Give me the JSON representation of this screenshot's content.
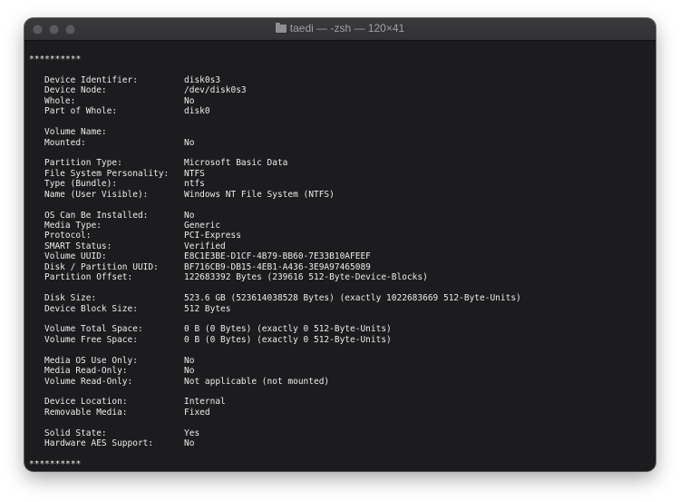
{
  "window": {
    "title": "taedi — -zsh — 120×41",
    "folder_icon": "folder-icon"
  },
  "terminal": {
    "separator_top": "**********",
    "separator_bottom": "**********",
    "groups": [
      [
        {
          "label": "Device Identifier:",
          "value": "disk0s3"
        },
        {
          "label": "Device Node:",
          "value": "/dev/disk0s3"
        },
        {
          "label": "Whole:",
          "value": "No"
        },
        {
          "label": "Part of Whole:",
          "value": "disk0"
        }
      ],
      [
        {
          "label": "Volume Name:",
          "value": ""
        },
        {
          "label": "Mounted:",
          "value": "No"
        }
      ],
      [
        {
          "label": "Partition Type:",
          "value": "Microsoft Basic Data"
        },
        {
          "label": "File System Personality:",
          "value": "NTFS"
        },
        {
          "label": "Type (Bundle):",
          "value": "ntfs"
        },
        {
          "label": "Name (User Visible):",
          "value": "Windows NT File System (NTFS)"
        }
      ],
      [
        {
          "label": "OS Can Be Installed:",
          "value": "No"
        },
        {
          "label": "Media Type:",
          "value": "Generic"
        },
        {
          "label": "Protocol:",
          "value": "PCI-Express"
        },
        {
          "label": "SMART Status:",
          "value": "Verified"
        },
        {
          "label": "Volume UUID:",
          "value": "E8C1E3BE-D1CF-4B79-BB60-7E33B10AFEEF"
        },
        {
          "label": "Disk / Partition UUID:",
          "value": "BF716CB9-DB15-4EB1-A436-3E9A97465089"
        },
        {
          "label": "Partition Offset:",
          "value": "122683392 Bytes (239616 512-Byte-Device-Blocks)"
        }
      ],
      [
        {
          "label": "Disk Size:",
          "value": "523.6 GB (523614038528 Bytes) (exactly 1022683669 512-Byte-Units)"
        },
        {
          "label": "Device Block Size:",
          "value": "512 Bytes"
        }
      ],
      [
        {
          "label": "Volume Total Space:",
          "value": "0 B (0 Bytes) (exactly 0 512-Byte-Units)"
        },
        {
          "label": "Volume Free Space:",
          "value": "0 B (0 Bytes) (exactly 0 512-Byte-Units)"
        }
      ],
      [
        {
          "label": "Media OS Use Only:",
          "value": "No"
        },
        {
          "label": "Media Read-Only:",
          "value": "No"
        },
        {
          "label": "Volume Read-Only:",
          "value": "Not applicable (not mounted)"
        }
      ],
      [
        {
          "label": "Device Location:",
          "value": "Internal"
        },
        {
          "label": "Removable Media:",
          "value": "Fixed"
        }
      ],
      [
        {
          "label": "Solid State:",
          "value": "Yes"
        },
        {
          "label": "Hardware AES Support:",
          "value": "No"
        }
      ]
    ]
  }
}
